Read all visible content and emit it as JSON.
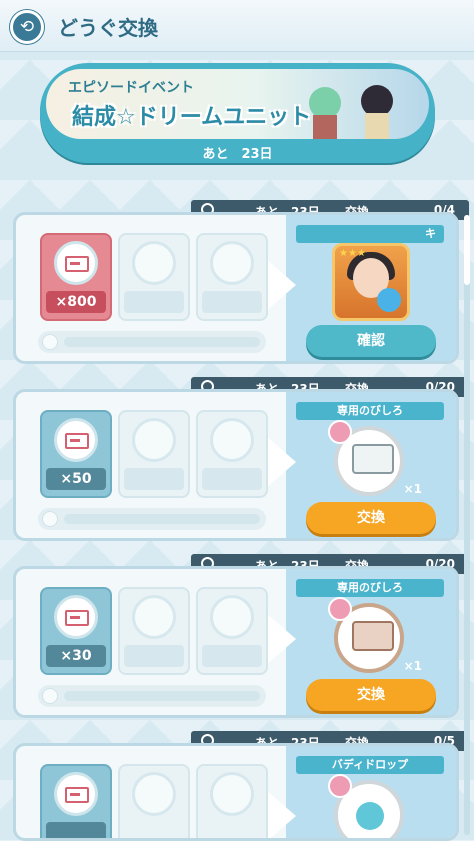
{
  "header": {
    "title": "どうぐ交換",
    "icon": "back-icon"
  },
  "banner": {
    "tag": "エピソードイベント",
    "title": "結成☆ドリームユニット",
    "time": "あと　23日"
  },
  "cards": [
    {
      "remain": "あと　23日",
      "exchange_label": "交換",
      "count": "0/4",
      "cost": "×800",
      "reward_label": "キ",
      "button": "確認",
      "button_style": "blue",
      "cost_style": "red",
      "reward_type": "character"
    },
    {
      "remain": "あと　23日",
      "exchange_label": "交換",
      "count": "0/20",
      "cost": "×50",
      "reward_label": "専用のびしろ",
      "reward_qty": "×1",
      "button": "交換",
      "button_style": "orange",
      "cost_style": "blue",
      "reward_type": "item"
    },
    {
      "remain": "あと　23日",
      "exchange_label": "交換",
      "count": "0/20",
      "cost": "×30",
      "reward_label": "専用のびしろ",
      "reward_qty": "×1",
      "button": "交換",
      "button_style": "orange",
      "cost_style": "blue",
      "reward_type": "item"
    },
    {
      "remain": "あと　23日",
      "exchange_label": "交換",
      "count": "0/5",
      "cost": "",
      "reward_label": "バディドロップ",
      "cost_style": "blue",
      "reward_type": "item"
    }
  ]
}
